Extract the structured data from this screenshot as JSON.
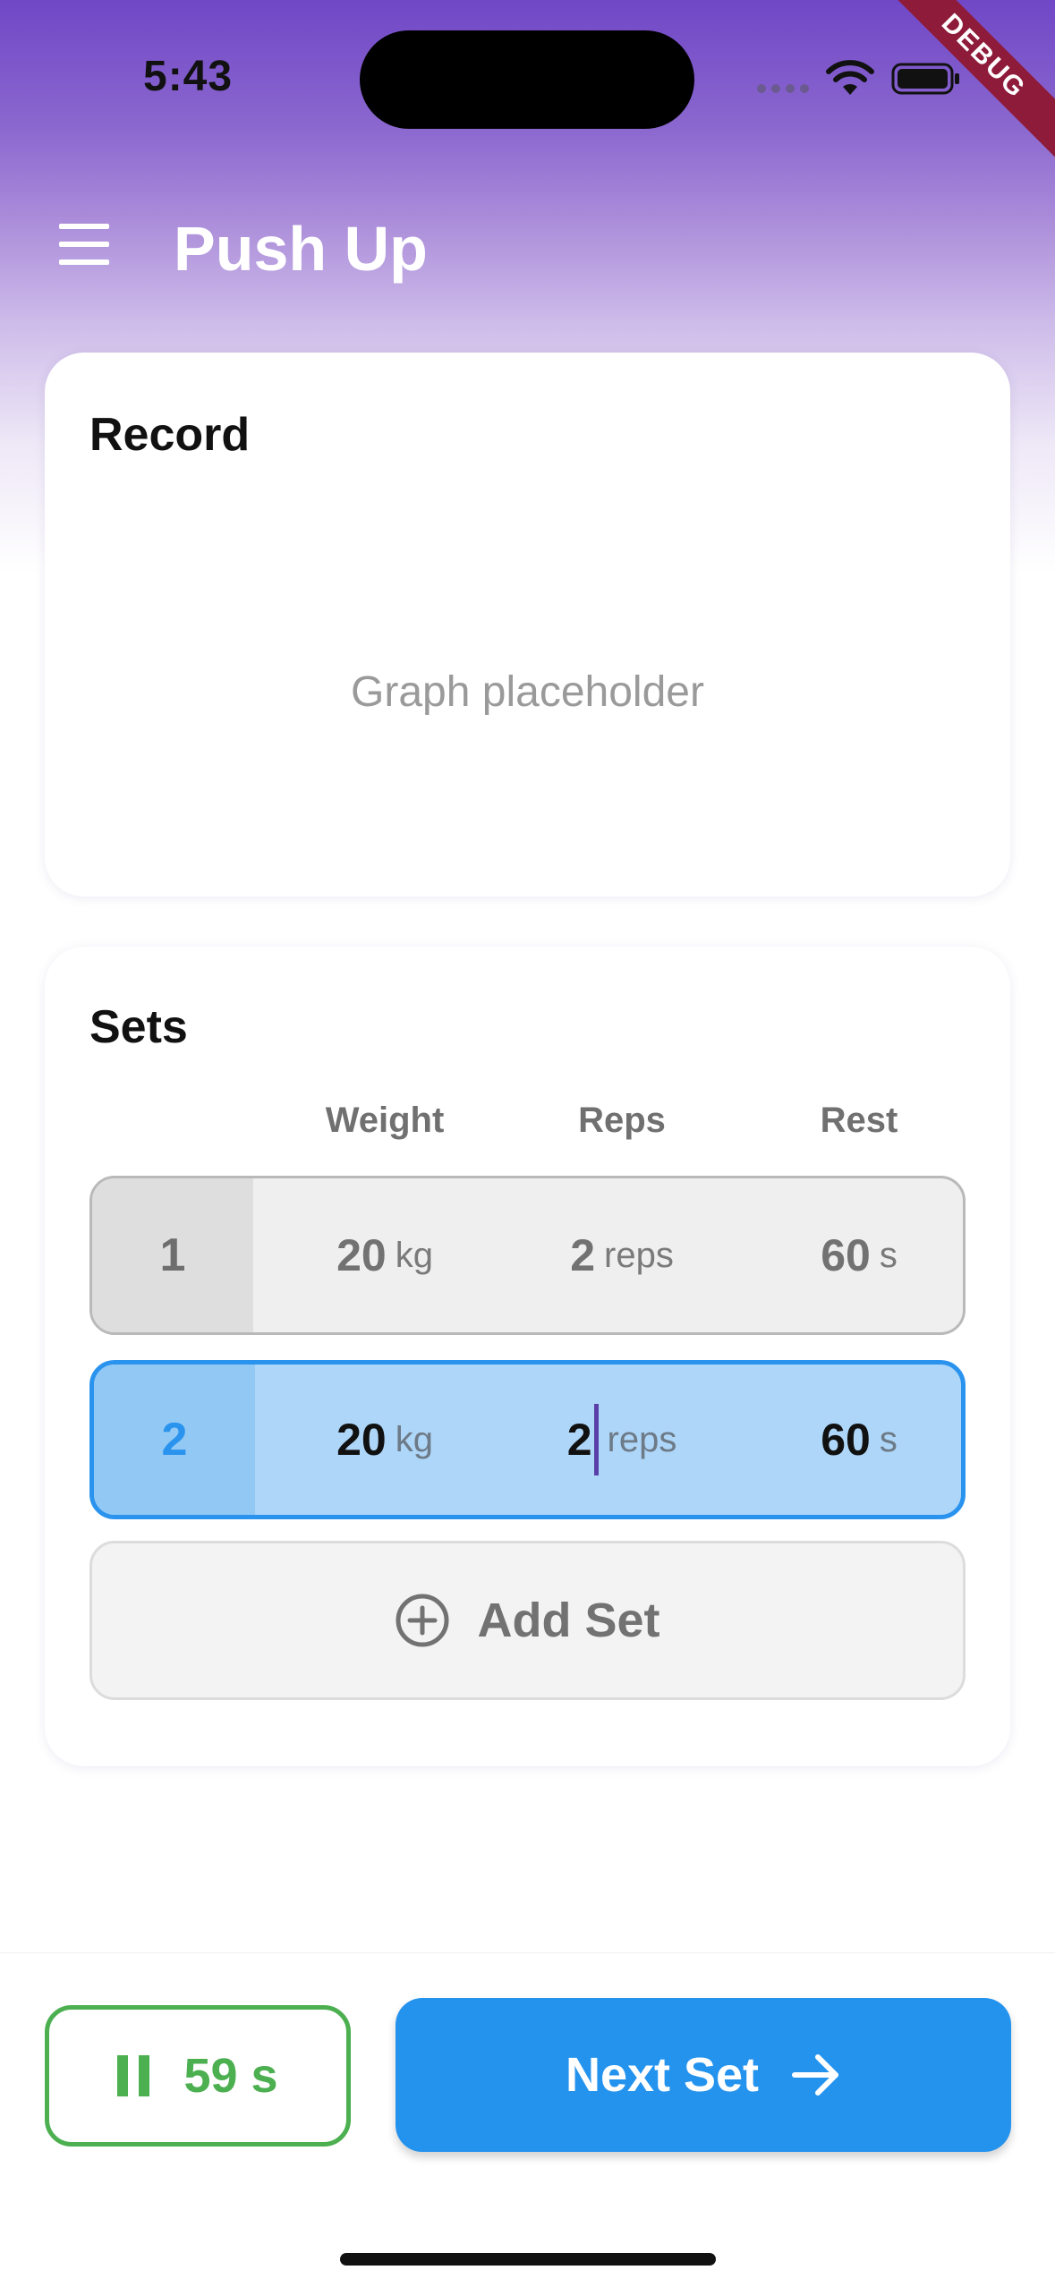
{
  "status_bar": {
    "time": "5:43",
    "debug_label": "DEBUG"
  },
  "app_bar": {
    "title": "Push Up",
    "menu_icon": "menu-icon"
  },
  "record_card": {
    "title": "Record",
    "graph_placeholder": "Graph placeholder"
  },
  "sets_card": {
    "title": "Sets",
    "columns": [
      "Weight",
      "Reps",
      "Rest"
    ],
    "rows": [
      {
        "index": "1",
        "weight": "20",
        "weight_unit": "kg",
        "reps": "2",
        "reps_unit": "reps",
        "rest": "60",
        "rest_unit": "s",
        "state": "done"
      },
      {
        "index": "2",
        "weight": "20",
        "weight_unit": "kg",
        "reps": "2",
        "reps_unit": "reps",
        "rest": "60",
        "rest_unit": "s",
        "state": "active"
      }
    ],
    "add_set_label": "Add Set"
  },
  "bottom_bar": {
    "timer_label": "59 s",
    "next_label": "Next Set"
  },
  "colors": {
    "accent_purple": "#7047c6",
    "active_blue": "#2493ee",
    "timer_green": "#4caf50",
    "debug_red": "#8e1b3a"
  }
}
